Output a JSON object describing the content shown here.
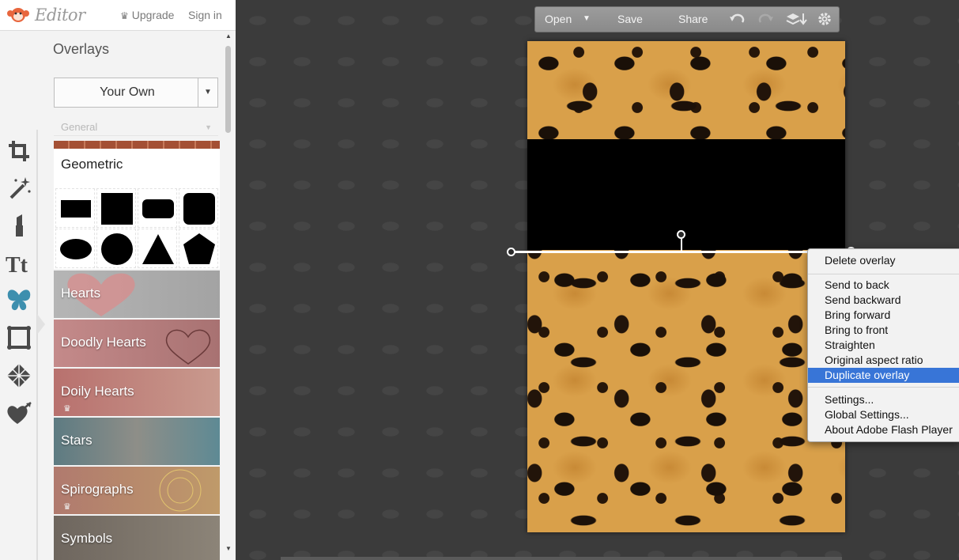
{
  "header": {
    "app_title": "Editor",
    "upgrade_label": "Upgrade",
    "signin_label": "Sign in"
  },
  "tool_rail": {
    "items": [
      {
        "icon": "crop-icon"
      },
      {
        "icon": "magic-wand-icon"
      },
      {
        "icon": "lipstick-icon"
      },
      {
        "icon": "text-icon",
        "label": "Tt"
      },
      {
        "icon": "butterfly-icon",
        "active": true
      },
      {
        "icon": "frame-icon"
      },
      {
        "icon": "texture-icon"
      },
      {
        "icon": "heart-arrow-icon"
      }
    ]
  },
  "panel": {
    "heading": "Overlays",
    "source_dropdown": "Your Own",
    "category_select": "General",
    "geometric": {
      "title": "Geometric",
      "shapes": [
        "rectangle",
        "square",
        "rounded-rectangle",
        "rounded-square",
        "ellipse",
        "circle",
        "triangle",
        "pentagon"
      ]
    },
    "categories": [
      {
        "label": "Hearts",
        "premium": false,
        "color": "#a8a8a8"
      },
      {
        "label": "Doodly Hearts",
        "premium": false,
        "color": "#b77f7f"
      },
      {
        "label": "Doily Hearts",
        "premium": true,
        "color": "#b0706c"
      },
      {
        "label": "Stars",
        "premium": false,
        "color": "#6a7f84"
      },
      {
        "label": "Spirographs",
        "premium": true,
        "color": "#a67a68"
      },
      {
        "label": "Symbols",
        "premium": false,
        "color": "#6c645c"
      }
    ]
  },
  "toolbar": {
    "open_label": "Open",
    "save_label": "Save",
    "share_label": "Share"
  },
  "context_menu": {
    "items": [
      {
        "label": "Delete overlay",
        "selected": false
      },
      {
        "label": "Send to back",
        "selected": false
      },
      {
        "label": "Send backward",
        "selected": false
      },
      {
        "label": "Bring forward",
        "selected": false
      },
      {
        "label": "Bring to front",
        "selected": false
      },
      {
        "label": "Straighten",
        "selected": false
      },
      {
        "label": "Original aspect ratio",
        "selected": false
      },
      {
        "label": "Duplicate overlay",
        "selected": true
      },
      {
        "label": "Settings...",
        "selected": false
      },
      {
        "label": "Global Settings...",
        "selected": false
      },
      {
        "label": "About Adobe Flash Player",
        "selected": false
      }
    ]
  },
  "colors": {
    "accent": "#3875d7",
    "active_tool": "#3d8fae",
    "workspace_bg": "#3a3a3a"
  }
}
